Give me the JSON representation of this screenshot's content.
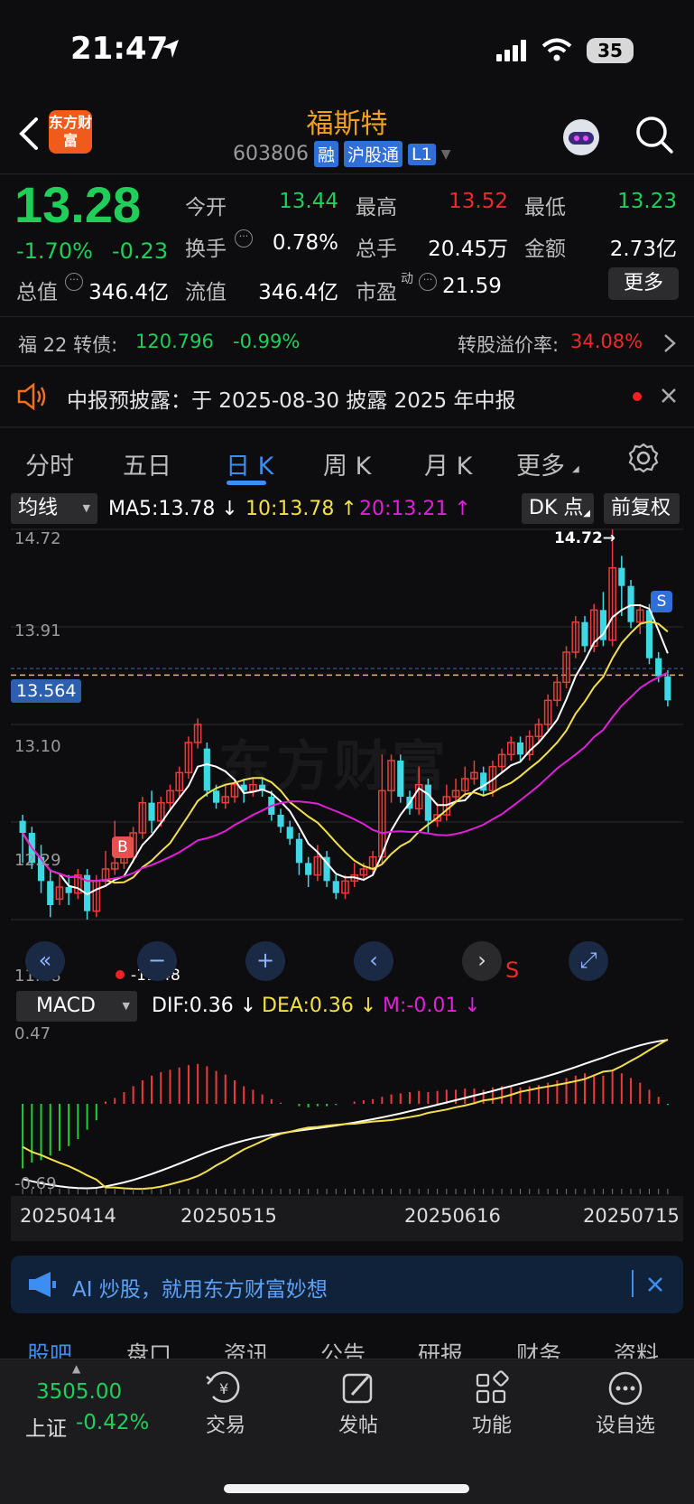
{
  "status": {
    "time": "21:47",
    "battery": "35"
  },
  "header": {
    "logo_text": "东方财富",
    "title": "福斯特",
    "code": "603806",
    "tags": [
      "融",
      "沪股通",
      "L1"
    ]
  },
  "quote": {
    "price": "13.28",
    "change_pct": "-1.70%",
    "change": "-0.23",
    "fields": [
      {
        "label": "今开",
        "value": "13.44",
        "color": "#1fcf5a"
      },
      {
        "label": "最高",
        "value": "13.52",
        "color": "#ee2a2a"
      },
      {
        "label": "最低",
        "value": "13.23",
        "color": "#1fcf5a"
      },
      {
        "label": "换手",
        "value": "0.78%",
        "color": "#ffffff"
      },
      {
        "label": "总手",
        "value": "20.45万",
        "color": "#ffffff"
      },
      {
        "label": "金额",
        "value": "2.73亿",
        "color": "#ffffff"
      },
      {
        "label": "总值",
        "value": "346.4亿",
        "color": "#ffffff"
      },
      {
        "label": "流值",
        "value": "346.4亿",
        "color": "#ffffff"
      },
      {
        "label": "市盈",
        "value": "21.59",
        "color": "#ffffff"
      }
    ],
    "pe_sup": "动",
    "more_label": "更多"
  },
  "bond": {
    "name": "福 22 转债:",
    "price": "120.796",
    "change": "-0.99%",
    "premium_label": "转股溢价率:",
    "premium": "34.08%"
  },
  "notice": {
    "text": "中报预披露：于 2025-08-30 披露 2025 年中报"
  },
  "tabs": [
    "分时",
    "五日",
    "日 K",
    "周 K",
    "月 K",
    "更多"
  ],
  "active_tab": "日 K",
  "kline": {
    "indicator_select": "均线",
    "ma5": "MA5:13.78 ↓",
    "ma10": "10:13.78 ↑",
    "ma20": "20:13.21 ↑",
    "dk_label": "DK 点",
    "adjust_label": "前复权",
    "y_ticks": [
      "14.72",
      "13.91",
      "13.10",
      "12.29",
      "11.48"
    ],
    "cursor_price": "13.564",
    "high_label": "14.72→",
    "low_label": "-11.48",
    "watermark": "东方财富",
    "signal_b": "B",
    "signal_s": "S",
    "s_mark": "S"
  },
  "macd": {
    "indicator_select": "MACD",
    "dif": "DIF:0.36 ↓",
    "dea": "DEA:0.36 ↓",
    "m": "M:-0.01 ↓",
    "y_top": "0.47",
    "y_bottom": "-0.69",
    "dates": [
      "20250414",
      "20250515",
      "20250616",
      "20250715"
    ]
  },
  "chart_data": {
    "type": "candlestick",
    "ylim": [
      11.48,
      14.72
    ],
    "candles": [
      [
        12.3,
        12.2,
        12.35,
        11.95
      ],
      [
        12.2,
        11.95,
        12.25,
        11.9
      ],
      [
        12.0,
        11.8,
        12.1,
        11.7
      ],
      [
        11.8,
        11.6,
        11.9,
        11.5
      ],
      [
        11.65,
        11.75,
        11.85,
        11.6
      ],
      [
        11.75,
        11.7,
        11.85,
        11.6
      ],
      [
        11.7,
        11.85,
        11.9,
        11.65
      ],
      [
        11.85,
        11.55,
        11.9,
        11.48
      ],
      [
        11.55,
        11.8,
        11.85,
        11.5
      ],
      [
        11.8,
        11.9,
        12.05,
        11.75
      ],
      [
        11.9,
        11.95,
        12.3,
        11.85
      ],
      [
        11.95,
        12.0,
        12.1,
        11.9
      ],
      [
        12.0,
        12.2,
        12.25,
        11.95
      ],
      [
        12.2,
        12.45,
        12.5,
        12.15
      ],
      [
        12.45,
        12.3,
        12.55,
        12.2
      ],
      [
        12.3,
        12.45,
        12.5,
        12.25
      ],
      [
        12.45,
        12.55,
        12.6,
        12.4
      ],
      [
        12.55,
        12.7,
        12.75,
        12.5
      ],
      [
        12.7,
        12.95,
        13.0,
        12.65
      ],
      [
        12.95,
        13.1,
        13.15,
        12.9
      ],
      [
        12.9,
        12.55,
        12.95,
        12.5
      ],
      [
        12.55,
        12.45,
        12.6,
        12.4
      ],
      [
        12.45,
        12.5,
        12.6,
        12.4
      ],
      [
        12.5,
        12.6,
        12.65,
        12.45
      ],
      [
        12.6,
        12.55,
        12.65,
        12.45
      ],
      [
        12.55,
        12.6,
        12.65,
        12.5
      ],
      [
        12.6,
        12.55,
        12.65,
        12.5
      ],
      [
        12.5,
        12.35,
        12.55,
        12.3
      ],
      [
        12.35,
        12.25,
        12.4,
        12.2
      ],
      [
        12.25,
        12.15,
        12.3,
        12.1
      ],
      [
        12.15,
        11.95,
        12.2,
        11.85
      ],
      [
        11.95,
        11.85,
        12.0,
        11.75
      ],
      [
        11.85,
        12.0,
        12.1,
        11.8
      ],
      [
        12.0,
        11.8,
        12.05,
        11.75
      ],
      [
        11.8,
        11.7,
        11.85,
        11.65
      ],
      [
        11.7,
        11.8,
        11.85,
        11.65
      ],
      [
        11.8,
        11.85,
        11.95,
        11.75
      ],
      [
        11.85,
        11.9,
        11.95,
        11.8
      ],
      [
        11.9,
        12.0,
        12.05,
        11.85
      ],
      [
        12.0,
        12.55,
        12.85,
        11.95
      ],
      [
        12.55,
        12.8,
        12.85,
        12.45
      ],
      [
        12.8,
        12.5,
        12.85,
        12.45
      ],
      [
        12.5,
        12.4,
        12.55,
        12.35
      ],
      [
        12.4,
        12.6,
        12.75,
        12.35
      ],
      [
        12.6,
        12.3,
        12.65,
        12.2
      ],
      [
        12.3,
        12.35,
        12.45,
        12.25
      ],
      [
        12.35,
        12.5,
        12.6,
        12.3
      ],
      [
        12.5,
        12.55,
        12.65,
        12.45
      ],
      [
        12.55,
        12.65,
        12.75,
        12.5
      ],
      [
        12.65,
        12.7,
        12.8,
        12.6
      ],
      [
        12.7,
        12.55,
        12.75,
        12.5
      ],
      [
        12.55,
        12.75,
        12.8,
        12.5
      ],
      [
        12.75,
        12.85,
        12.9,
        12.7
      ],
      [
        12.85,
        12.95,
        13.0,
        12.8
      ],
      [
        12.95,
        12.85,
        13.0,
        12.8
      ],
      [
        12.85,
        13.0,
        13.05,
        12.8
      ],
      [
        13.0,
        13.1,
        13.15,
        12.95
      ],
      [
        13.1,
        13.3,
        13.35,
        13.05
      ],
      [
        13.3,
        13.45,
        13.5,
        13.25
      ],
      [
        13.45,
        13.7,
        13.75,
        13.4
      ],
      [
        13.7,
        13.95,
        14.0,
        13.65
      ],
      [
        13.95,
        13.75,
        14.0,
        13.7
      ],
      [
        13.75,
        14.05,
        14.1,
        13.7
      ],
      [
        14.05,
        13.8,
        14.2,
        13.75
      ],
      [
        13.8,
        14.4,
        14.72,
        13.75
      ],
      [
        14.4,
        14.25,
        14.5,
        14.0
      ],
      [
        14.25,
        13.95,
        14.3,
        13.9
      ],
      [
        13.95,
        14.05,
        14.1,
        13.85
      ],
      [
        14.05,
        13.65,
        14.1,
        13.6
      ],
      [
        13.65,
        13.5,
        13.7,
        13.45
      ],
      [
        13.5,
        13.3,
        13.55,
        13.25
      ]
    ],
    "macd_hist": [
      -0.55,
      -0.5,
      -0.48,
      -0.44,
      -0.4,
      -0.36,
      -0.3,
      -0.22,
      -0.14,
      0.02,
      0.05,
      0.1,
      0.15,
      0.2,
      0.24,
      0.27,
      0.29,
      0.31,
      0.33,
      0.34,
      0.32,
      0.28,
      0.25,
      0.2,
      0.15,
      0.12,
      0.08,
      0.04,
      0.01,
      0.0,
      -0.02,
      -0.03,
      -0.02,
      -0.02,
      -0.01,
      0.0,
      0.02,
      0.03,
      0.04,
      0.06,
      0.08,
      0.09,
      0.1,
      0.11,
      0.1,
      0.11,
      0.12,
      0.12,
      0.13,
      0.13,
      0.12,
      0.14,
      0.15,
      0.15,
      0.14,
      0.15,
      0.16,
      0.18,
      0.2,
      0.22,
      0.24,
      0.26,
      0.25,
      0.24,
      0.28,
      0.26,
      0.22,
      0.18,
      0.12,
      0.06,
      -0.01
    ]
  },
  "banner": {
    "text": "AI 炒股，就用东方财富妙想"
  },
  "bottom_tabs": [
    "股吧",
    "盘口",
    "资讯",
    "公告",
    "研报",
    "财务",
    "资料"
  ],
  "index": {
    "value": "3505.00",
    "name": "上证",
    "change": "-0.42%"
  },
  "bottom_nav": [
    {
      "label": "交易",
      "icon": "yen-exchange-icon"
    },
    {
      "label": "发帖",
      "icon": "compose-icon"
    },
    {
      "label": "功能",
      "icon": "grid-icon"
    },
    {
      "label": "设自选",
      "icon": "more-dots-icon"
    }
  ]
}
